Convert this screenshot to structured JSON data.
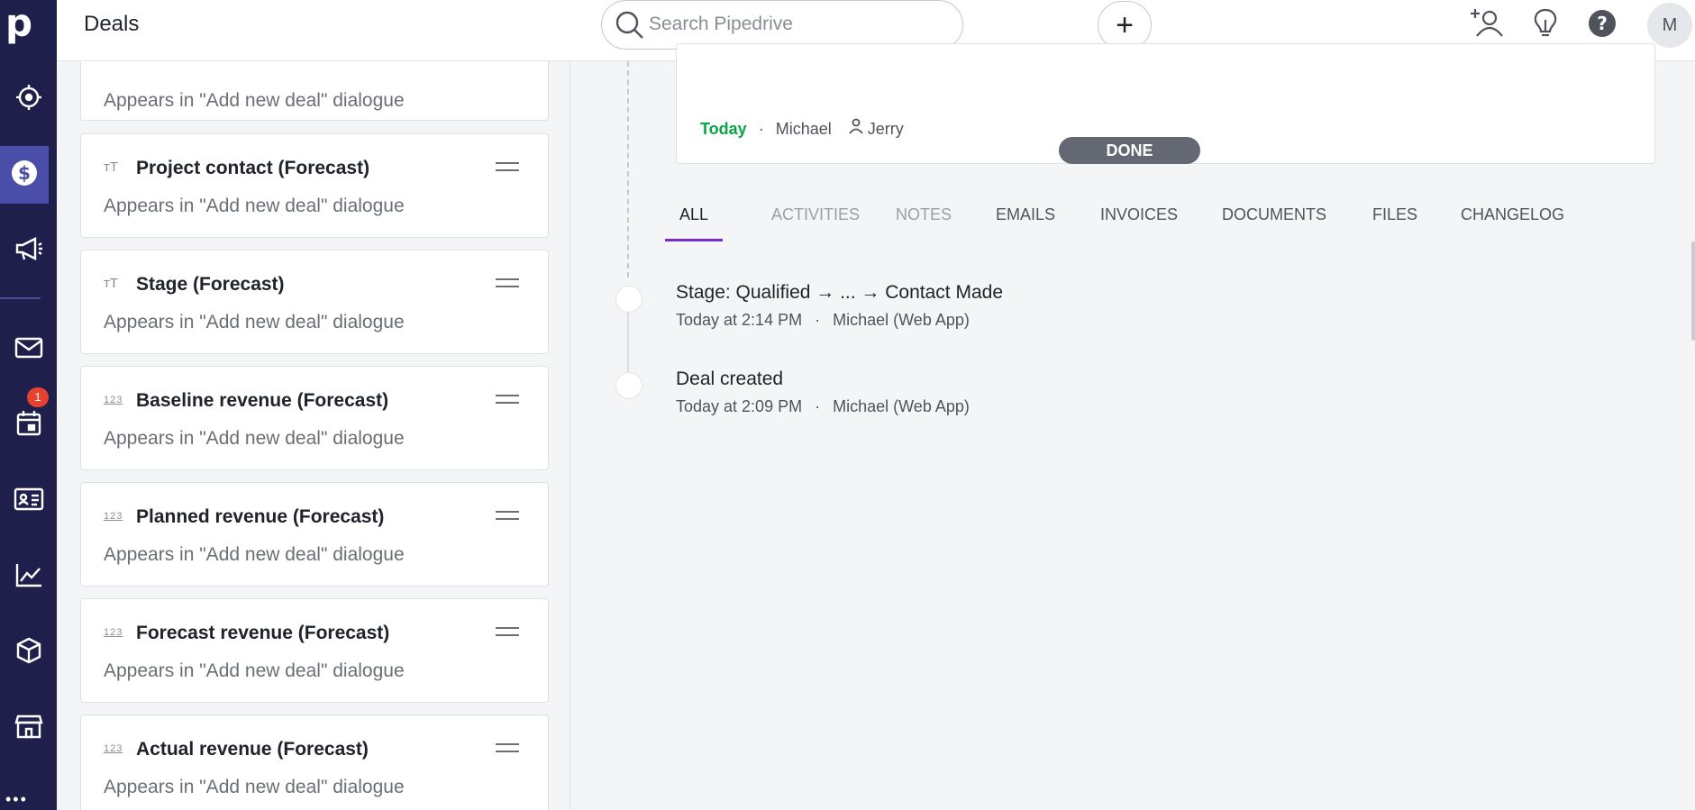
{
  "app": {
    "page_title": "Deals",
    "brand_letter": "p"
  },
  "nav": {
    "items": [
      {
        "name": "focus",
        "icon": "target-icon"
      },
      {
        "name": "deals",
        "icon": "dollar-icon",
        "active": true
      },
      {
        "name": "campaigns",
        "icon": "megaphone-icon"
      },
      {
        "name": "mail",
        "icon": "mail-icon"
      },
      {
        "name": "activities",
        "icon": "calendar-icon",
        "badge": "1"
      },
      {
        "name": "contacts",
        "icon": "contact-card-icon"
      },
      {
        "name": "insights",
        "icon": "chart-icon"
      },
      {
        "name": "products",
        "icon": "box-icon"
      },
      {
        "name": "marketplace",
        "icon": "store-icon"
      }
    ],
    "badge": "1",
    "more": "•••"
  },
  "search": {
    "placeholder": "Search Pipedrive",
    "value": ""
  },
  "header": {
    "add_label": "+",
    "avatar_initial": "M"
  },
  "fields": {
    "top_subtitle": "Appears in \"Add new deal\" dialogue",
    "items": [
      {
        "icon": "ᴛT",
        "name": "Project contact (Forecast)",
        "subtitle": "Appears in \"Add new deal\" dialogue"
      },
      {
        "icon": "ᴛT",
        "name": "Stage (Forecast)",
        "subtitle": "Appears in \"Add new deal\" dialogue"
      },
      {
        "icon": "123",
        "name": "Baseline revenue (Forecast)",
        "subtitle": "Appears in \"Add new deal\" dialogue"
      },
      {
        "icon": "123",
        "name": "Planned revenue (Forecast)",
        "subtitle": "Appears in \"Add new deal\" dialogue"
      },
      {
        "icon": "123",
        "name": "Forecast revenue (Forecast)",
        "subtitle": "Appears in \"Add new deal\" dialogue"
      },
      {
        "icon": "123",
        "name": "Actual revenue (Forecast)",
        "subtitle": "Appears in \"Add new deal\" dialogue"
      }
    ]
  },
  "activity": {
    "when": "Today",
    "owner": "Michael",
    "participant": "Jerry",
    "status": "DONE"
  },
  "tabs": [
    {
      "label": "ALL",
      "state": "active"
    },
    {
      "label": "ACTIVITIES",
      "state": "muted"
    },
    {
      "label": "NOTES",
      "state": "muted"
    },
    {
      "label": "EMAILS",
      "state": "normal"
    },
    {
      "label": "INVOICES",
      "state": "normal"
    },
    {
      "label": "DOCUMENTS",
      "state": "normal"
    },
    {
      "label": "FILES",
      "state": "normal"
    },
    {
      "label": "CHANGELOG",
      "state": "normal"
    }
  ],
  "history": [
    {
      "title": "Stage: Qualified → ... → Contact Made",
      "time": "Today at 2:14 PM",
      "by": "Michael (Web App)"
    },
    {
      "title": "Deal created",
      "time": "Today at 2:09 PM",
      "by": "Michael (Web App)"
    }
  ],
  "colors": {
    "rail": "#1f1f4b",
    "rail_active": "#4b4ea8",
    "accent_tab": "#7b2bc5",
    "today_green": "#08a742",
    "badge_red": "#e5432f"
  }
}
